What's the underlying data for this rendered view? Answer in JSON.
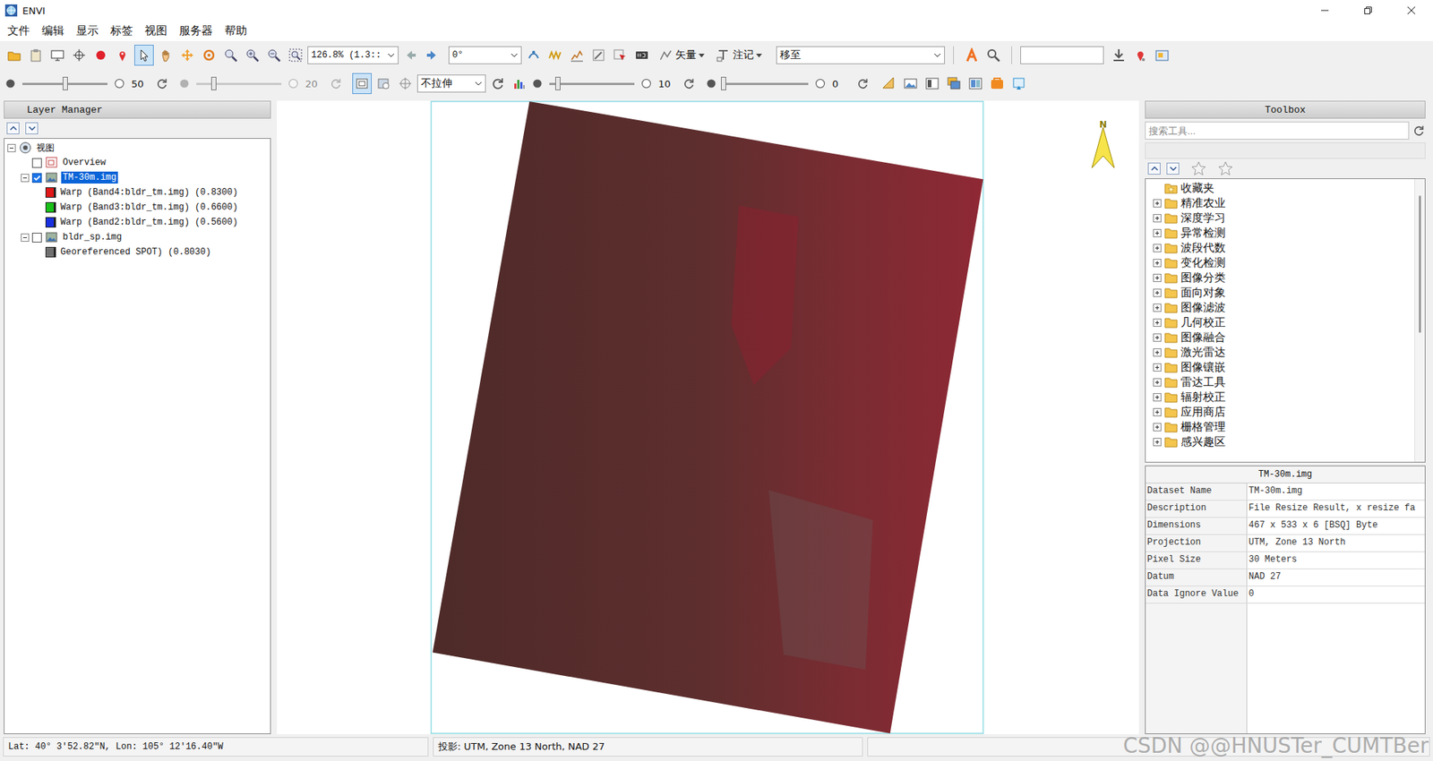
{
  "window": {
    "title": "ENVI"
  },
  "menu": [
    "文件",
    "编辑",
    "显示",
    "标签",
    "视图",
    "服务器",
    "帮助"
  ],
  "toolbar": {
    "tools": [
      {
        "kind": "open",
        "selected": false
      },
      {
        "kind": "paste",
        "selected": false
      },
      {
        "kind": "display",
        "selected": false
      },
      {
        "kind": "crosshair",
        "selected": false
      },
      {
        "kind": "record",
        "selected": false
      },
      {
        "kind": "pin",
        "selected": false
      },
      {
        "kind": "select",
        "selected": true
      },
      {
        "kind": "pan",
        "selected": false
      },
      {
        "kind": "fly",
        "selected": false
      },
      {
        "kind": "rotate",
        "selected": false
      },
      {
        "kind": "zoom",
        "selected": false
      },
      {
        "kind": "zoom-in",
        "selected": false
      },
      {
        "kind": "zoom-out",
        "selected": false
      },
      {
        "kind": "zoom-box",
        "selected": false
      }
    ],
    "zoom": "126.8% (1.3::",
    "history": [
      {
        "kind": "back"
      },
      {
        "kind": "forward"
      }
    ],
    "rotation": "0°",
    "tools2": [
      {
        "kind": "link"
      },
      {
        "kind": "wave"
      },
      {
        "kind": "profile"
      },
      {
        "kind": "edit"
      },
      {
        "kind": "roi"
      },
      {
        "kind": "counter"
      }
    ],
    "vector": "矢量",
    "annotation": "注记",
    "goto": "移至",
    "tools3": [
      {
        "kind": "text-a"
      },
      {
        "kind": "search"
      }
    ],
    "search_value": "",
    "tools4": [
      {
        "kind": "download"
      },
      {
        "kind": "place-pin"
      },
      {
        "kind": "export"
      }
    ]
  },
  "display": {
    "sliders": [
      {
        "level": 0.5,
        "value": "50",
        "disabled": false
      },
      {
        "level": 0.2,
        "value": "20",
        "disabled": true
      },
      {
        "level": 0.1,
        "value": "10",
        "disabled": false
      },
      {
        "level": 0,
        "value": "0",
        "disabled": false
      }
    ],
    "view_tools": [
      {
        "kind": "frame",
        "selected": true
      },
      {
        "kind": "chip",
        "selected": false
      },
      {
        "kind": "target",
        "selected": false
      }
    ],
    "stretch": "不拉伸",
    "stretch_tools": [
      {
        "kind": "refresh"
      },
      {
        "kind": "histogram"
      }
    ],
    "tools": [
      {
        "kind": "ruler"
      },
      {
        "kind": "image"
      },
      {
        "kind": "layout"
      },
      {
        "kind": "layers"
      },
      {
        "kind": "compare"
      },
      {
        "kind": "portal"
      },
      {
        "kind": "swipe"
      }
    ]
  },
  "layers": {
    "title": "Layer Manager",
    "tree": [
      {
        "label": "视图",
        "level": 0,
        "kind": "view",
        "expanded": true,
        "selected": false
      },
      {
        "label": "Overview",
        "level": 1,
        "kind": "overview",
        "checked": false,
        "selected": false
      },
      {
        "label": "TM-30m.img",
        "level": 1,
        "kind": "raster",
        "expanded": true,
        "checked": true,
        "selected": true
      },
      {
        "label": "Warp (Band4:bldr_tm.img) (0.8300)",
        "level": 2,
        "kind": "band",
        "color": "#e01818",
        "selected": false
      },
      {
        "label": "Warp (Band3:bldr_tm.img) (0.6600)",
        "level": 2,
        "kind": "band",
        "color": "#18c018",
        "selected": false
      },
      {
        "label": "Warp (Band2:bldr_tm.img) (0.5600)",
        "level": 2,
        "kind": "band",
        "color": "#1830e0",
        "selected": false
      },
      {
        "label": "bldr_sp.img",
        "level": 1,
        "kind": "raster",
        "expanded": true,
        "checked": false,
        "selected": false
      },
      {
        "label": "Georeferenced SPOT) (0.8030)",
        "level": 2,
        "kind": "band",
        "color": "#707070",
        "selected": false
      }
    ]
  },
  "map": {
    "north": "N"
  },
  "toolbox": {
    "title": "Toolbox",
    "placeholder": "搜索工具...",
    "items": [
      {
        "label": "收藏夹",
        "kind": "favorites"
      },
      {
        "label": "精准农业",
        "kind": "folder",
        "expanded": false
      },
      {
        "label": "深度学习",
        "kind": "folder",
        "expanded": false
      },
      {
        "label": "异常检测",
        "kind": "folder",
        "expanded": false
      },
      {
        "label": "波段代数",
        "kind": "folder",
        "expanded": false
      },
      {
        "label": "变化检测",
        "kind": "folder",
        "expanded": false
      },
      {
        "label": "图像分类",
        "kind": "folder",
        "expanded": false
      },
      {
        "label": "面向对象",
        "kind": "folder",
        "expanded": false
      },
      {
        "label": "图像滤波",
        "kind": "folder",
        "expanded": false
      },
      {
        "label": "几何校正",
        "kind": "folder",
        "expanded": false
      },
      {
        "label": "图像融合",
        "kind": "folder",
        "expanded": false
      },
      {
        "label": "激光雷达",
        "kind": "folder",
        "expanded": false
      },
      {
        "label": "图像镶嵌",
        "kind": "folder",
        "expanded": false
      },
      {
        "label": "雷达工具",
        "kind": "folder",
        "expanded": false
      },
      {
        "label": "辐射校正",
        "kind": "folder",
        "expanded": false
      },
      {
        "label": "应用商店",
        "kind": "folder",
        "expanded": false
      },
      {
        "label": "栅格管理",
        "kind": "folder",
        "expanded": false
      },
      {
        "label": "感兴趣区",
        "kind": "folder",
        "expanded": false
      }
    ]
  },
  "properties": {
    "header": "TM-30m.img",
    "rows": [
      {
        "key": "Dataset Name",
        "value": "TM-30m.img"
      },
      {
        "key": "Description",
        "value": "File Resize Result, x resize fa"
      },
      {
        "key": "Dimensions",
        "value": "467 x 533 x 6 [BSQ] Byte"
      },
      {
        "key": "Projection",
        "value": "UTM, Zone 13 North"
      },
      {
        "key": "Pixel Size",
        "value": "30 Meters"
      },
      {
        "key": "Datum",
        "value": "NAD 27"
      },
      {
        "key": "Data Ignore Value",
        "value": "0"
      }
    ]
  },
  "status_bar": {
    "location": "Lat: 40° 3′52.82″N, Lon: 105° 12′16.40″W",
    "projection": "投影: UTM, Zone 13 North, NAD 27"
  },
  "watermark": "CSDN @@HNUSTer_CUMTBer"
}
